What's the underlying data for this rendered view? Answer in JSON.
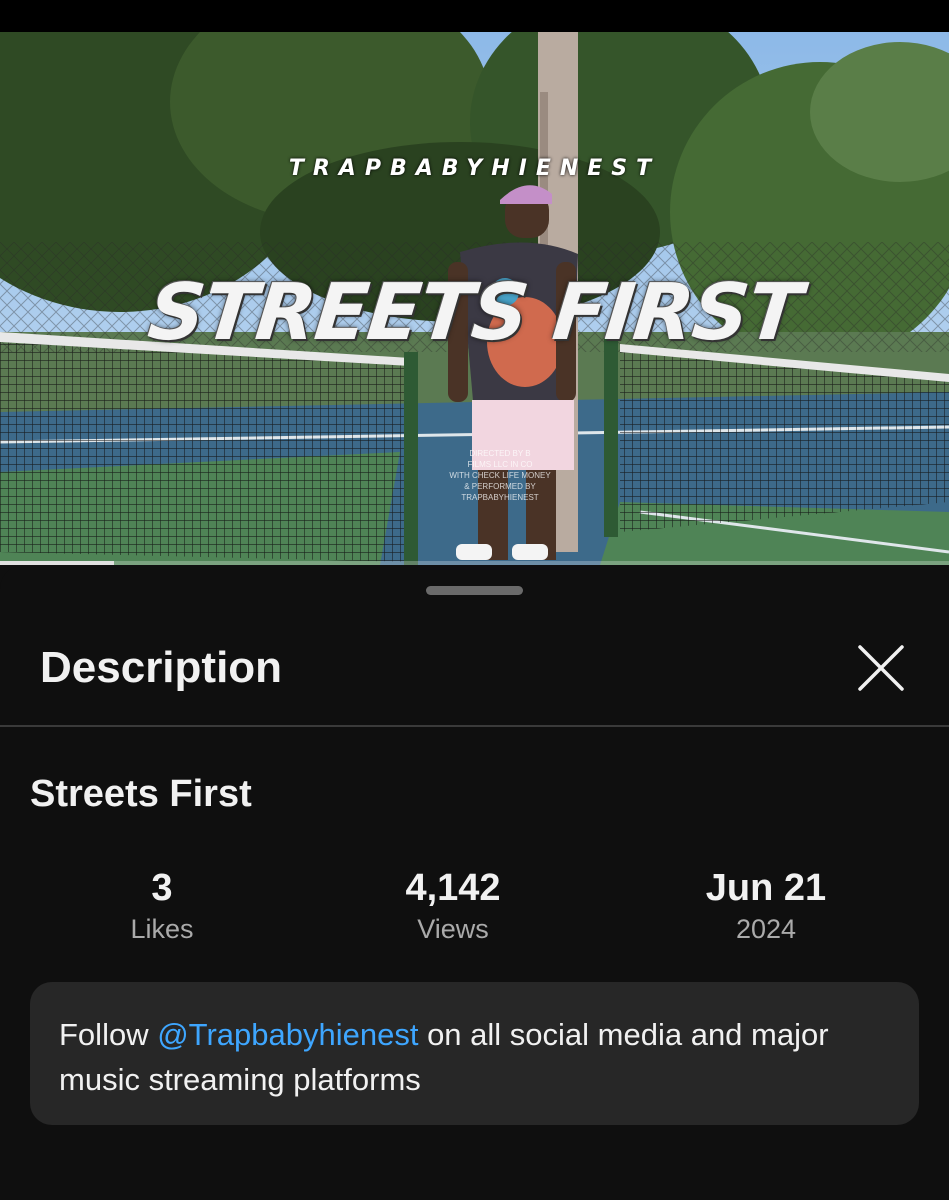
{
  "video": {
    "brand_overlay": "TRAPBABYHIENEST",
    "title_overlay": "STREETS FIRST",
    "credits": [
      "DIRECTED BY B",
      "FILMS LLC IN CO",
      "WITH CHECK LIFE MONEY",
      "& PERFORMED BY TRAPBABYHIENEST"
    ],
    "progress_fraction": 0.12
  },
  "sheet": {
    "title": "Description",
    "close_icon": "close-icon"
  },
  "video_info": {
    "title": "Streets First",
    "stats": {
      "likes": {
        "value": "3",
        "label": "Likes"
      },
      "views": {
        "value": "4,142",
        "label": "Views"
      },
      "date": {
        "value": "Jun 21",
        "label": "2024"
      }
    }
  },
  "description": {
    "prefix": "Follow ",
    "mention": "@Trapbabyhienest",
    "suffix": " on all social media and major music streaming platforms"
  },
  "colors": {
    "background": "#0f0f0f",
    "card": "#272727",
    "link": "#3ea6ff",
    "secondary_text": "#aaaaaa"
  }
}
